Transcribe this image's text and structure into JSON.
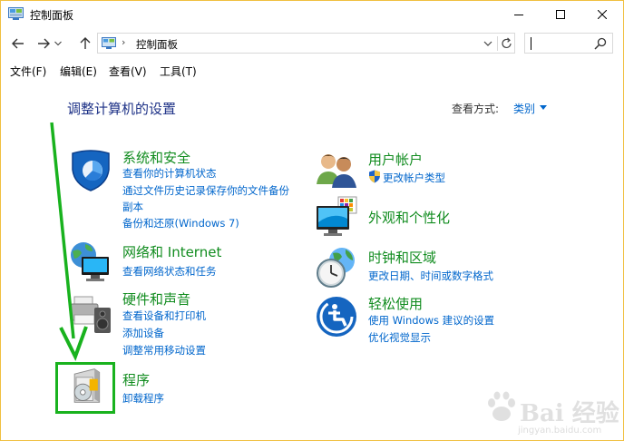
{
  "window": {
    "title": "控制面板",
    "controls": {
      "minimize": "minimize",
      "maximize": "maximize",
      "close": "close"
    }
  },
  "nav": {
    "address_separator": "›",
    "address_text": "控制面板",
    "search_value": ""
  },
  "menu": [
    {
      "label": "文件(F)"
    },
    {
      "label": "编辑(E)"
    },
    {
      "label": "查看(V)"
    },
    {
      "label": "工具(T)"
    }
  ],
  "content": {
    "title": "调整计算机的设置",
    "view_by_label": "查看方式:",
    "view_by_value": "类别"
  },
  "categories_left": [
    {
      "title": "系统和安全",
      "links": [
        "查看你的计算机状态",
        "通过文件历史记录保存你的文件备份",
        "副本",
        "备份和还原(Windows 7)"
      ]
    },
    {
      "title": "网络和 Internet",
      "links": [
        "查看网络状态和任务"
      ]
    },
    {
      "title": "硬件和声音",
      "links": [
        "查看设备和打印机",
        "添加设备",
        "调整常用移动设置"
      ]
    },
    {
      "title": "程序",
      "links": [
        "卸载程序"
      ]
    }
  ],
  "categories_right": [
    {
      "title": "用户帐户",
      "links": [
        "更改帐户类型"
      ]
    },
    {
      "title": "外观和个性化",
      "links": []
    },
    {
      "title": "时钟和区域",
      "links": [
        "更改日期、时间或数字格式"
      ]
    },
    {
      "title": "轻松使用",
      "links": [
        "使用 Windows 建议的设置",
        "优化视觉显示"
      ]
    }
  ],
  "watermark": {
    "main": "Bai  经验",
    "sub": "jingyan.baidu.com"
  },
  "colors": {
    "link": "#0066cc",
    "category": "#118c1f",
    "title": "#1e3287",
    "highlight": "#19b21e"
  }
}
